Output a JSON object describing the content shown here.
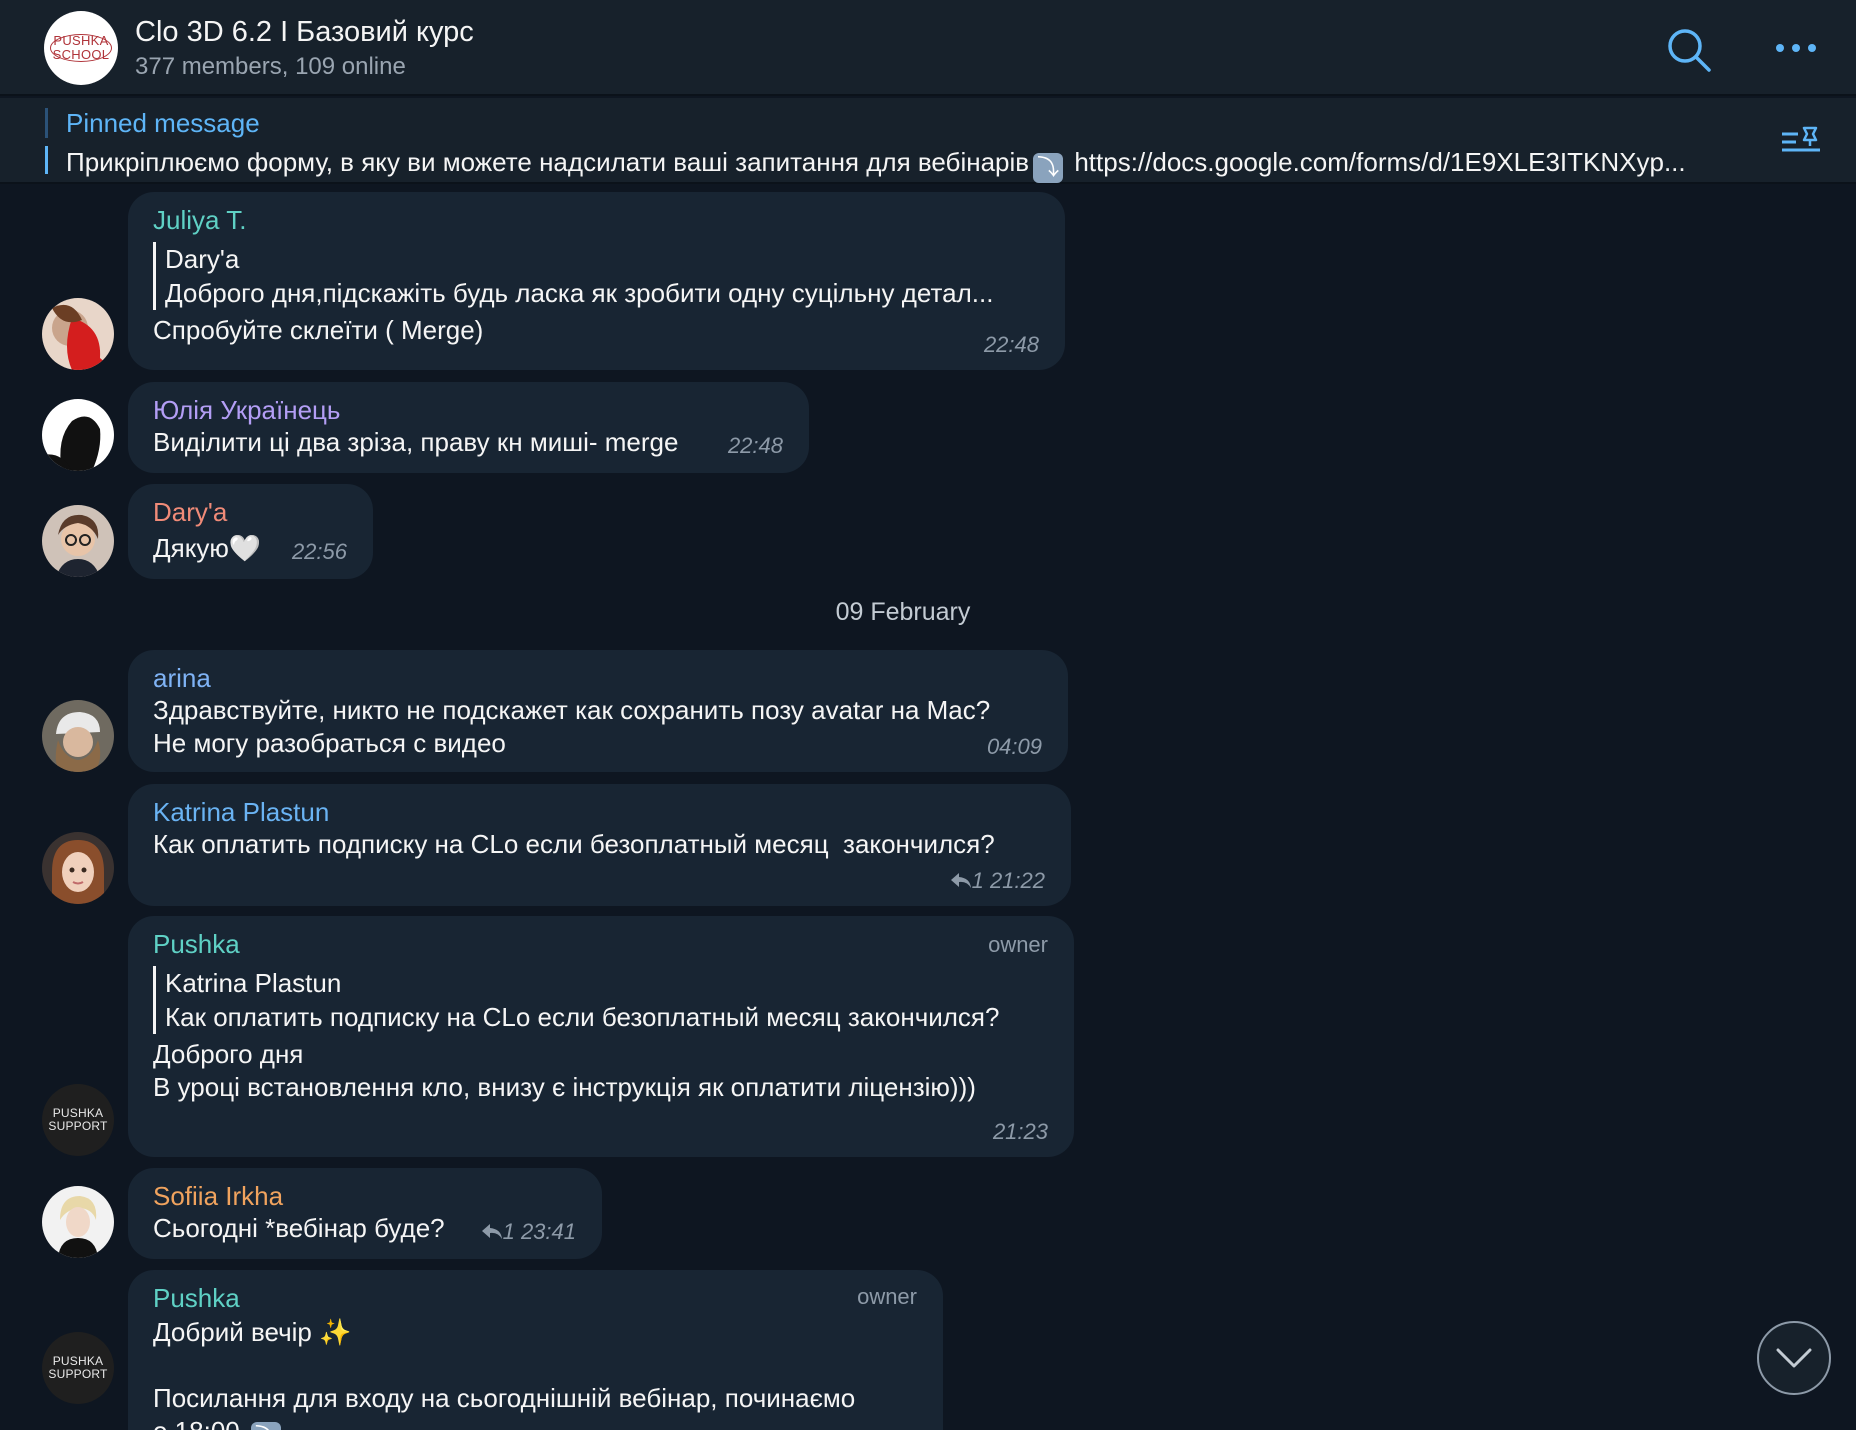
{
  "header": {
    "title": "Clo 3D 6.2 І Базовий курс",
    "subtitle": "377 members, 109 online",
    "logo_line1": "PUSHKA",
    "logo_line2": "SCHOOL"
  },
  "pinned": {
    "label": "Pinned message",
    "text_before": "Прикріплюємо форму, в яку ви можете надсилати ваші запитання для вебінарів",
    "arrow_emoji": "⤵",
    "text_after": "https://docs.google.com/forms/d/1E9XLE3ITKNXyp..."
  },
  "colors": {
    "background": "#0e1621",
    "bubble": "#182533",
    "header": "#17212b",
    "accent": "#5eb5f7"
  },
  "support_avatar": {
    "line1": "PUSHKA",
    "line2": "SUPPORT"
  },
  "date_separator": "09 February",
  "messages": [
    {
      "sender": "Juliya T.",
      "sender_color": "#5fd1c5",
      "reply_name": "Dary'a",
      "reply_text": "Доброго дня,підскажіть будь ласка як зробити одну суцільну детал...",
      "text": "Спробуйте склеїти ( Merge)",
      "time": "22:48"
    },
    {
      "sender": "Юлія Українець",
      "sender_color": "#b39ef5",
      "text": "Виділити ці два зріза, праву кн миші- merge",
      "time": "22:48"
    },
    {
      "sender": "Dary'a",
      "sender_color": "#f08b78",
      "text": "Дякую",
      "emoji": "🤍",
      "time": "22:56"
    },
    {
      "sender": "arina",
      "sender_color": "#7fb3f5",
      "text": "Здравствуйте, никто не подскажет как сохранить позу avatar на Mac?\nНе могу разобраться с видео",
      "time": "04:09"
    },
    {
      "sender": "Katrina Plastun",
      "sender_color": "#6ab3f3",
      "text": "Как оплатить подписку на CLo если безоплатный месяц  закончился?",
      "replies": "1",
      "time": "21:22"
    },
    {
      "sender": "Pushka",
      "sender_color": "#5fd1c5",
      "badge": "owner",
      "reply_name": "Katrina Plastun",
      "reply_text": "Как оплатить подписку на CLo если безоплатный месяц  закончился?",
      "text": "Доброго дня\nВ уроці встановлення кло, внизу є інструкція як оплатити ліцензію)))",
      "time": "21:23"
    },
    {
      "sender": "Sofiia Irkha",
      "sender_color": "#f0a35e",
      "text": "Сьогодні *вебінар буде?",
      "replies": "1",
      "time": "23:41"
    },
    {
      "sender": "Pushka",
      "sender_color": "#5fd1c5",
      "badge": "owner",
      "text_line1": "Добрий вечір",
      "sparkle": "✨",
      "text_line2": "Посилання для входу на сьогоднішній вебінар, починаємо",
      "text_line3": "о 18:00",
      "arrow_emoji": "⤵"
    }
  ]
}
